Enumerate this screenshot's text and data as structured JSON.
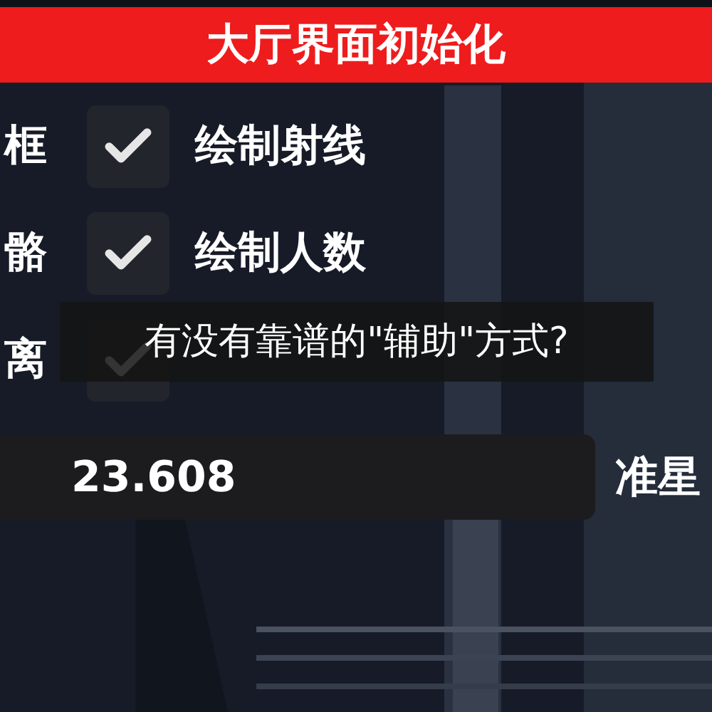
{
  "title": "大厅界面初始化",
  "rows": [
    {
      "side_label": "框",
      "checked": true,
      "label": "绘制射线"
    },
    {
      "side_label": "骼",
      "checked": true,
      "label": "绘制人数"
    },
    {
      "side_label": "离",
      "checked": true
    }
  ],
  "value_field": {
    "value": "23.608"
  },
  "right_label": "准星",
  "caption": "有没有靠谱的\"辅助\"方式?"
}
